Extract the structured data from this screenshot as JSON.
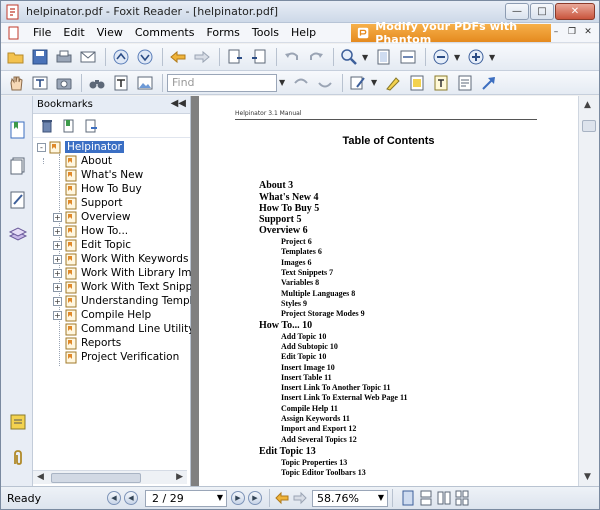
{
  "window": {
    "title": "helpinator.pdf - Foxit Reader - [helpinator.pdf]"
  },
  "menu": {
    "items": [
      "File",
      "Edit",
      "View",
      "Comments",
      "Forms",
      "Tools",
      "Help"
    ],
    "promo": "Modify your PDFs with Phantom"
  },
  "toolbar": {
    "find_placeholder": "Find"
  },
  "bookmarks_panel": {
    "title": "Bookmarks",
    "items": [
      {
        "label": "Helpinator"
      },
      {
        "label": "About"
      },
      {
        "label": "What's New"
      },
      {
        "label": "How To Buy"
      },
      {
        "label": "Support"
      },
      {
        "label": "Overview"
      },
      {
        "label": "How To..."
      },
      {
        "label": "Edit Topic"
      },
      {
        "label": "Work With Keywords"
      },
      {
        "label": "Work With Library Imag"
      },
      {
        "label": "Work With Text Snippe"
      },
      {
        "label": "Understanding Templat"
      },
      {
        "label": "Compile Help"
      },
      {
        "label": "Command Line Utility"
      },
      {
        "label": "Reports"
      },
      {
        "label": "Project Verification"
      }
    ]
  },
  "document": {
    "running_head": "Helpinator 3.1 Manual",
    "toc_title": "Table of Contents",
    "entries": [
      {
        "text": "About  3"
      },
      {
        "text": "What's New  4"
      },
      {
        "text": "How To Buy  5"
      },
      {
        "text": "Support  5"
      },
      {
        "text": "Overview  6"
      },
      {
        "text": "Project  6"
      },
      {
        "text": "Templates  6"
      },
      {
        "text": "Images  6"
      },
      {
        "text": "Text Snippets  7"
      },
      {
        "text": "Variables  8"
      },
      {
        "text": "Multiple Languages  8"
      },
      {
        "text": "Styles  9"
      },
      {
        "text": "Project Storage Modes  9"
      },
      {
        "text": "How To...  10"
      },
      {
        "text": "Add Topic  10"
      },
      {
        "text": "Add Subtopic  10"
      },
      {
        "text": "Edit Topic  10"
      },
      {
        "text": "Insert Image  10"
      },
      {
        "text": "Insert Table  11"
      },
      {
        "text": "Insert Link To Another Topic  11"
      },
      {
        "text": "Insert Link To External Web Page  11"
      },
      {
        "text": "Compile Help  11"
      },
      {
        "text": "Assign Keywords  11"
      },
      {
        "text": "Import and Export  12"
      },
      {
        "text": "Add Several Topics  12"
      },
      {
        "text": "Edit Topic  13"
      },
      {
        "text": "Topic Properties  13"
      },
      {
        "text": "Topic Editor Toolbars  13"
      }
    ]
  },
  "status": {
    "text": "Ready",
    "page": "2 / 29",
    "zoom": "58.76%"
  }
}
